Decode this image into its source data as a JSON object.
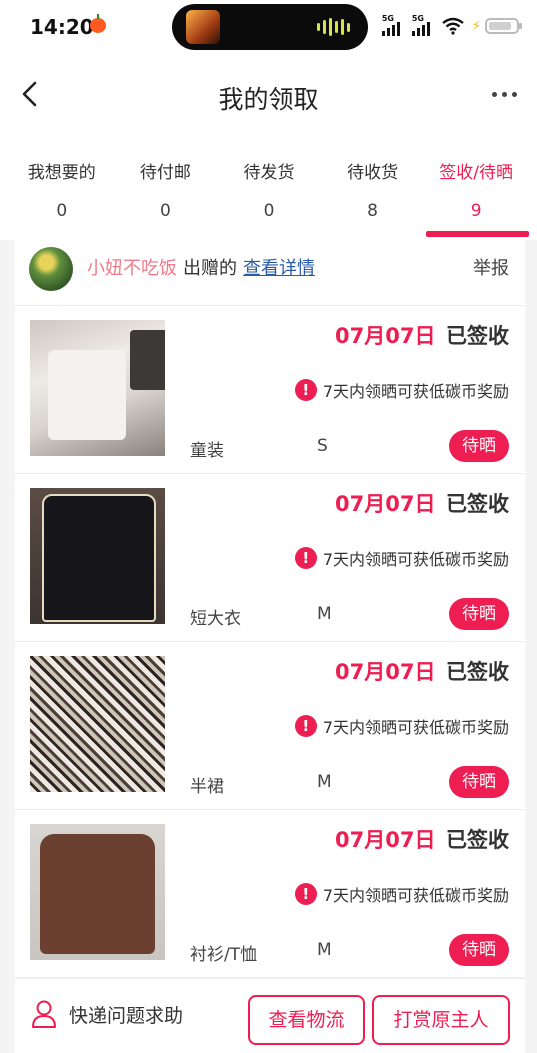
{
  "status_bar": {
    "time": "14:20",
    "signal_labels": [
      "5G",
      "5G"
    ]
  },
  "header": {
    "title": "我的领取",
    "back_icon": "chevron-left-icon",
    "more_icon": "more-dots-icon"
  },
  "tabs": [
    {
      "label": "我想要的",
      "count": "0",
      "active": false
    },
    {
      "label": "待付邮",
      "count": "0",
      "active": false
    },
    {
      "label": "待发货",
      "count": "0",
      "active": false
    },
    {
      "label": "待收货",
      "count": "8",
      "active": false
    },
    {
      "label": "签收/待晒",
      "count": "9",
      "active": true
    }
  ],
  "donor": {
    "name": "小妞不吃饭",
    "action": "出赠的",
    "link": "查看详情",
    "report": "举报"
  },
  "items": [
    {
      "date": "07月07日",
      "status": "已签收",
      "notice": "7天内领晒可获低碳币奖励",
      "category": "童装",
      "size": "S",
      "button": "待晒"
    },
    {
      "date": "07月07日",
      "status": "已签收",
      "notice": "7天内领晒可获低碳币奖励",
      "category": "短大衣",
      "size": "M",
      "button": "待晒"
    },
    {
      "date": "07月07日",
      "status": "已签收",
      "notice": "7天内领晒可获低碳币奖励",
      "category": "半裙",
      "size": "M",
      "button": "待晒"
    },
    {
      "date": "07月07日",
      "status": "已签收",
      "notice": "7天内领晒可获低碳币奖励",
      "category": "衬衫/T恤",
      "size": "M",
      "button": "待晒"
    }
  ],
  "bottom": {
    "help": "快递问题求助",
    "logistics": "查看物流",
    "tip": "打赏原主人"
  },
  "colors": {
    "accent": "#ee1d52",
    "donor_name": "#f07a8a",
    "link": "#2a5ca8"
  }
}
